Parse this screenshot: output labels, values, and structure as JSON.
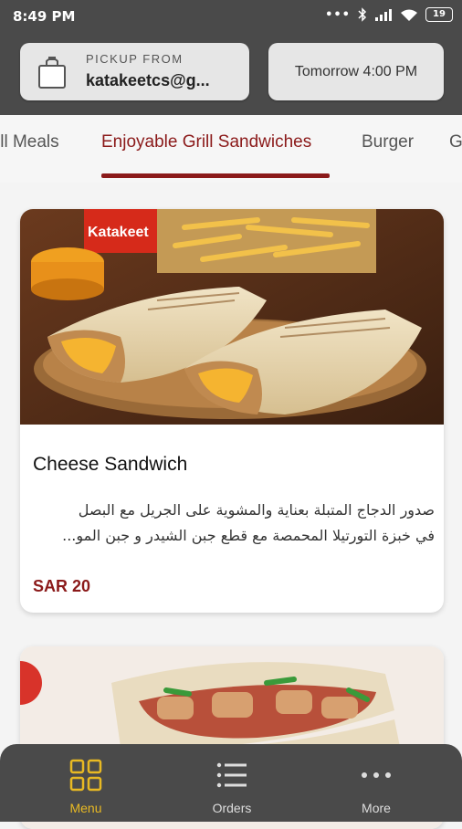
{
  "status_bar": {
    "time": "8:49 PM",
    "battery": "19",
    "icons": [
      "more-dots-icon",
      "bluetooth-icon",
      "signal-icon",
      "wifi-icon",
      "battery-icon"
    ]
  },
  "header": {
    "pickup_label": "PICKUP FROM",
    "pickup_value": "katakeetcs@g...",
    "time_value": "Tomorrow 4:00 PM"
  },
  "tabs": [
    {
      "label": "ill Meals"
    },
    {
      "label": "Enjoyable Grill Sandwiches",
      "active": true
    },
    {
      "label": "Burger"
    },
    {
      "label": "G"
    }
  ],
  "items": [
    {
      "title": "Cheese Sandwich",
      "description": "صدور الدجاج المتبلة بعناية والمشوية على الجريل مع البصل\nفي خبزة التورتيلا المحمصة مع قطع جبن الشيدر  و جبن المو...",
      "price": "SAR 20",
      "image_brand_text": "Katakeet"
    }
  ],
  "bottom_nav": [
    {
      "label": "Menu",
      "icon": "grid-icon",
      "active": true
    },
    {
      "label": "Orders",
      "icon": "list-icon",
      "active": false
    },
    {
      "label": "More",
      "icon": "more-dots-icon",
      "active": false
    }
  ],
  "colors": {
    "header_bg": "#4a4a4a",
    "accent": "#8b1a1a",
    "active_nav": "#e8b923"
  }
}
